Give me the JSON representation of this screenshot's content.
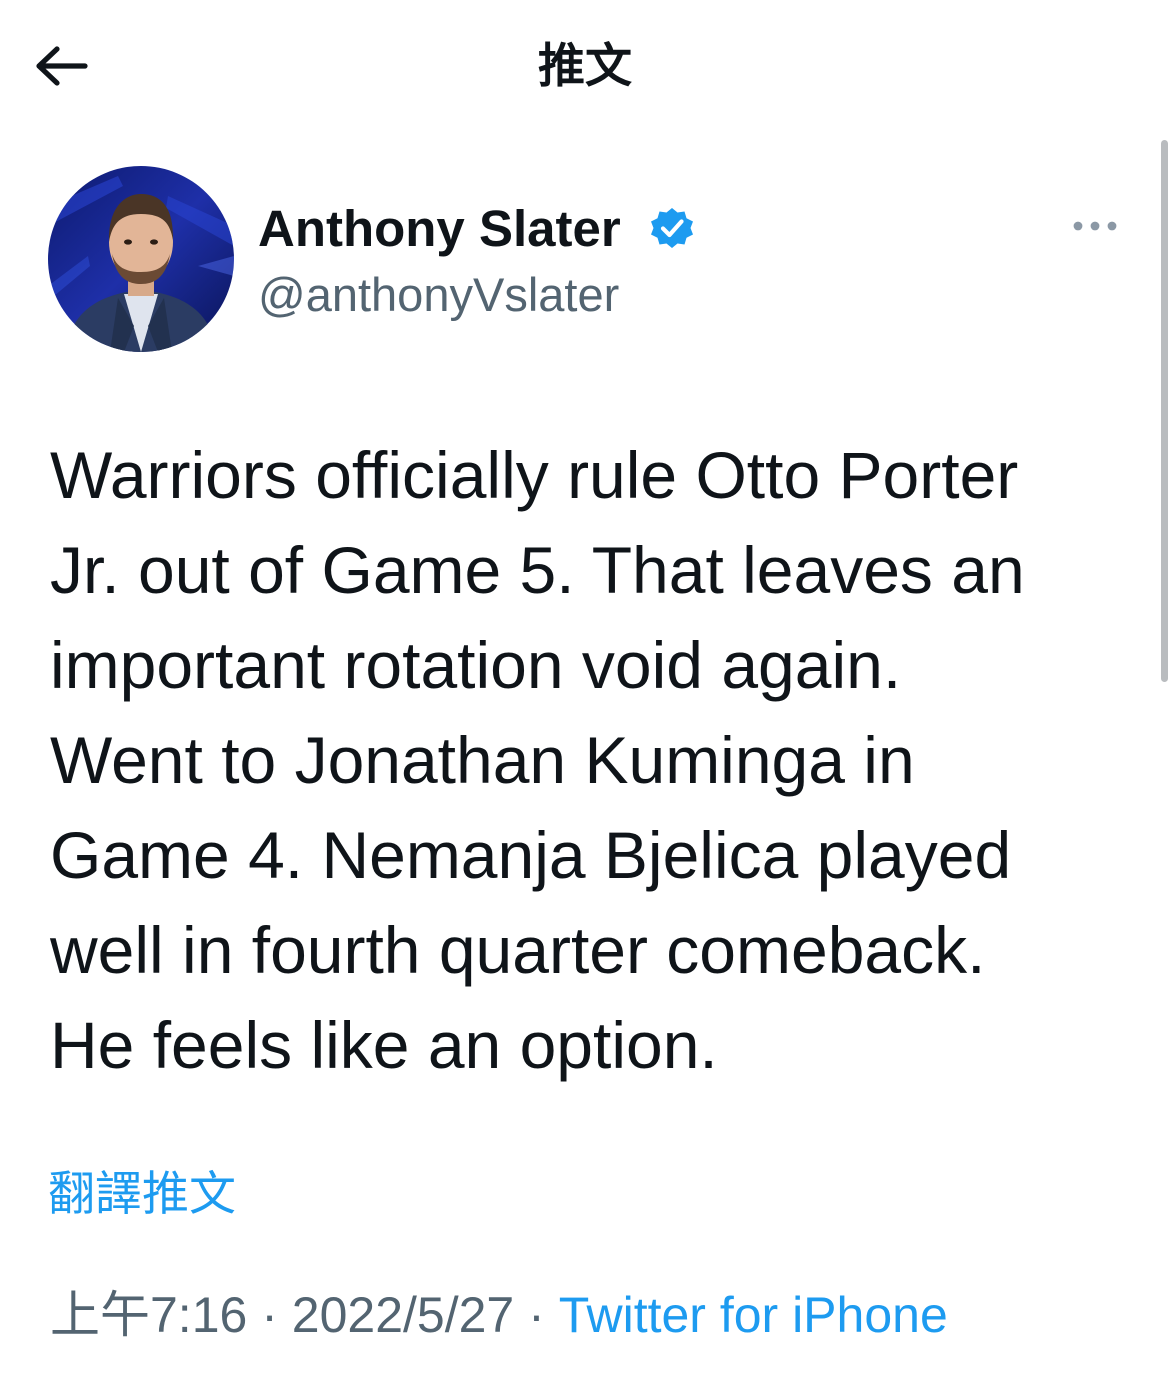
{
  "header": {
    "back_icon": "arrow-left-icon",
    "title": "推文"
  },
  "tweet": {
    "author": {
      "name": "Anthony Slater",
      "handle": "@anthonyVslater",
      "verified_icon": "verified-badge-icon",
      "verified_color": "#1d9bf0"
    },
    "more_icon": "more-dots-icon",
    "text_lines": [
      "Warriors officially rule Otto Porter",
      "Jr. out of Game 5. That leaves an",
      "important rotation void again.",
      "Went to Jonathan Kuminga in",
      "Game 4. Nemanja Bjelica played",
      "well in fourth quarter comeback.",
      "He feels like an option."
    ],
    "translate_label": "翻譯推文",
    "time": "上午7:16",
    "separator": "·",
    "date": "2022/5/27",
    "source": "Twitter for iPhone"
  },
  "colors": {
    "accent": "#1d9bf0",
    "secondary_text": "#536471",
    "primary_text": "#0f1419"
  }
}
